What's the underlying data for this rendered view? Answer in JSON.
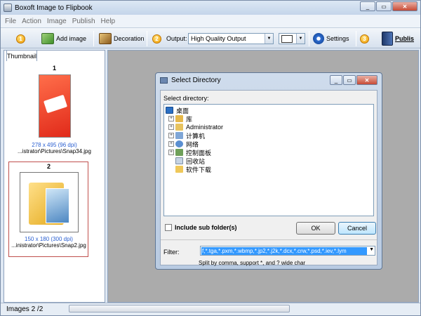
{
  "app": {
    "title": "Boxoft Image to Flipbook"
  },
  "menu": [
    "File",
    "Action",
    "Image",
    "Publish",
    "Help"
  ],
  "toolbar": {
    "step1": "1",
    "add_image": "Add image",
    "decoration": "Decoration",
    "step2": "2",
    "output_label": "Output:",
    "output_value": "High Quality Output",
    "settings": "Settings",
    "step3": "3",
    "publish": "Publis"
  },
  "left_panel": {
    "tab": "Thumbnail",
    "items": [
      {
        "num": "1",
        "dim": "278 x 495 (96 dpi)",
        "path": "...istrator\\Pictures\\Snap34.jpg"
      },
      {
        "num": "2",
        "dim": "150 x 180 (300 dpi)",
        "path": "...inistrator\\Pictures\\Snap2.jpg"
      }
    ]
  },
  "status": {
    "text": "Images 2 /2"
  },
  "dialog": {
    "title": "Select Directory",
    "label": "Select directory:",
    "tree": {
      "root": "桌面",
      "children": [
        "库",
        "Administrator",
        "计算机",
        "网络",
        "控制面板",
        "回收站",
        "软件下载"
      ]
    },
    "include_sub": "Include sub folder(s)",
    "ok": "OK",
    "cancel": "Cancel",
    "filter_label": "Filter:",
    "filter_value": "f,*.tga,*.pxm,*.wbmp,*.jp2,*.j2k,*.dcx,*.crw,*.psd,*.iev,*.lym",
    "hint": "Split by comma, support *, and ? wide char"
  },
  "icons": {
    "app": "flipbook-icon",
    "add_image": "add-image-icon",
    "decoration": "decoration-icon",
    "settings": "gear-icon",
    "publish": "book-icon"
  },
  "colors": {
    "selection": "#3399ff",
    "workspace": "#ababab",
    "thumb_link": "#2a5fd0"
  }
}
